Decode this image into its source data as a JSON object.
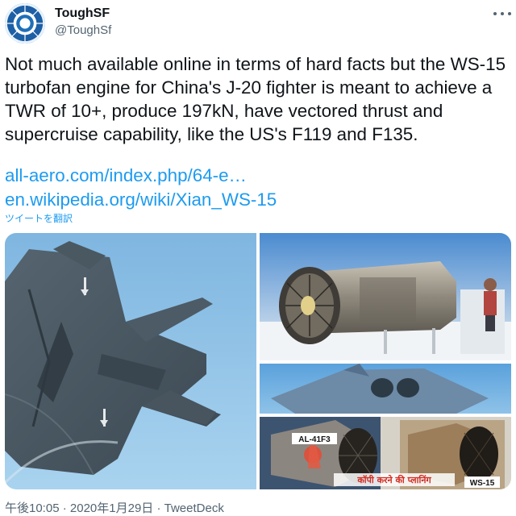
{
  "header": {
    "display_name": "ToughSF",
    "handle": "@ToughSf",
    "more_icon": "more-horizontal-icon"
  },
  "tweet": {
    "text": "Not much available online in terms of hard facts but the WS-15 turbofan engine for China's J-20 fighter is meant to achieve a TWR of 10+, produce 197kN, have vectored thrust and supercruise capability, like the US's F119 and F135.",
    "links": [
      "all-aero.com/index.php/64-e…",
      "en.wikipedia.org/wiki/Xian_WS-15"
    ],
    "translate_label": "ツイートを翻訳"
  },
  "media": {
    "overlay_al41f3": "AL-41F3",
    "overlay_hindi": "कॉपी करने की प्लानिंग",
    "overlay_ws15": "WS-15"
  },
  "footer": {
    "time": "午後10:05",
    "separator": "·",
    "date": "2020年1月29日",
    "source": "TweetDeck"
  },
  "colors": {
    "link": "#1d9bf0",
    "secondary_text": "#536471",
    "sky": "#8fc3e8"
  }
}
